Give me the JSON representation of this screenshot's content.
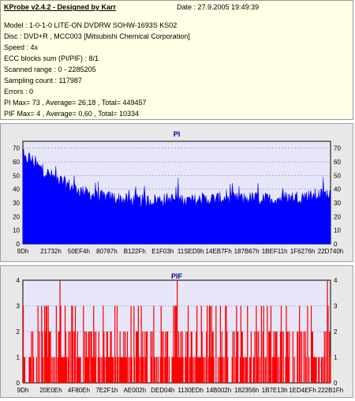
{
  "header": {
    "title": "KProbe v2.4.2 - Designed by Karr",
    "date": "Date : 27.9.2005 19:49:39"
  },
  "info_lines": [
    "Model : 1-0-1-0 LITE-ON DVDRW SOHW-1693S KS02",
    "Disc : DVD+R , MCC003 [Mitsubishi Chemical Corporation]",
    "Speed : 4x",
    "ECC blocks sum (PI/PIF) : 8/1",
    "Scanned range : 0 - 2285205",
    "Sampling count : 117987",
    "Errors : 0",
    "PI Max= 73 , Average= 26,18 , Total= 449457",
    "PIF Max= 4 , Average= 0,60 , Total= 10334"
  ],
  "colors": {
    "pi_series": "#0000ff",
    "pif_series": "#ff0000",
    "plot_bg": "#e6e6f8",
    "title": "#0000a0"
  },
  "chart_data": [
    {
      "type": "area",
      "title": "PI",
      "ylim": [
        0,
        75
      ],
      "yticks": [
        "0",
        "10",
        "20",
        "30",
        "40",
        "50",
        "60",
        "70"
      ],
      "tick_labels": [
        "9Dh",
        "21732h",
        "50EF4h",
        "80787h",
        "B122Fh",
        "E1F03h",
        "11SED9h",
        "14EB7Fh",
        "187B67h",
        "1BEF11h",
        "1F6276h",
        "22D740h"
      ],
      "profile": [
        [
          0,
          58
        ],
        [
          0.02,
          62
        ],
        [
          0.05,
          55
        ],
        [
          0.08,
          50
        ],
        [
          0.12,
          45
        ],
        [
          0.16,
          40
        ],
        [
          0.2,
          36
        ],
        [
          0.25,
          33
        ],
        [
          0.3,
          32
        ],
        [
          0.35,
          30
        ],
        [
          0.4,
          30
        ],
        [
          0.45,
          31
        ],
        [
          0.5,
          31
        ],
        [
          0.55,
          30
        ],
        [
          0.6,
          31
        ],
        [
          0.65,
          32
        ],
        [
          0.7,
          31
        ],
        [
          0.75,
          32
        ],
        [
          0.8,
          31
        ],
        [
          0.85,
          32
        ],
        [
          0.9,
          33
        ],
        [
          0.95,
          34
        ],
        [
          1.0,
          35
        ]
      ],
      "max": 73,
      "average": 26.18
    },
    {
      "type": "bar",
      "title": "PIF",
      "ylim": [
        0,
        4
      ],
      "yticks": [
        "0",
        "1",
        "2",
        "3",
        "4"
      ],
      "tick_labels": [
        "9Dh",
        "20E0Eh",
        "4F80Eh",
        "7E2F1h",
        "AE002h",
        "DED04h",
        "1130EDh",
        "14B002h",
        "182356h",
        "1B7E13h",
        "1ED4EFh",
        "222B1Fh"
      ],
      "max": 4,
      "average": 0.6
    }
  ]
}
